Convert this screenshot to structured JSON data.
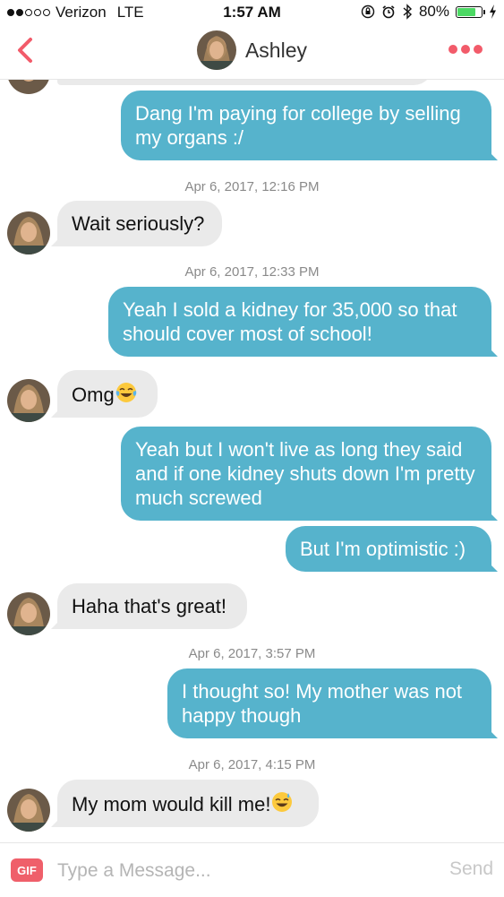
{
  "status_bar": {
    "carrier": "Verizon",
    "network": "LTE",
    "time": "1:57 AM",
    "battery_percent": "80%",
    "battery_level": 0.8,
    "signal_bars": 2,
    "signal_total": 5,
    "icons": [
      "orientation-lock-icon",
      "alarm-icon",
      "bluetooth-icon",
      "battery-icon",
      "charging-icon"
    ]
  },
  "header": {
    "contact_name": "Ashley",
    "back_icon": "chevron-left-icon",
    "more_icon": "more-dots-icon",
    "accent_color": "#f25b6a"
  },
  "colors": {
    "outgoing_bubble": "#56b3cc",
    "incoming_bubble": "#eaeaea"
  },
  "messages": [
    {
      "type": "outgoing",
      "text": "Dang I'm paying for college by selling my organs :/"
    },
    {
      "type": "timestamp",
      "text": "Apr 6, 2017, 12:16 PM"
    },
    {
      "type": "incoming",
      "text": "Wait seriously?"
    },
    {
      "type": "timestamp",
      "text": "Apr 6, 2017, 12:33 PM"
    },
    {
      "type": "outgoing",
      "text": "Yeah I sold a kidney for 35,000 so that should cover most of school!"
    },
    {
      "type": "incoming",
      "text": "Omg",
      "emoji": "tears-of-joy-emoji"
    },
    {
      "type": "outgoing",
      "text": "Yeah but I won't live as long they said and if one kidney shuts down I'm pretty much screwed"
    },
    {
      "type": "outgoing",
      "text": "But I'm optimistic :)"
    },
    {
      "type": "incoming",
      "text": "Haha that's great!"
    },
    {
      "type": "timestamp",
      "text": "Apr 6, 2017, 3:57 PM"
    },
    {
      "type": "outgoing",
      "text": "I thought so! My mother was not happy though"
    },
    {
      "type": "timestamp",
      "text": "Apr 6, 2017, 4:15 PM"
    },
    {
      "type": "incoming",
      "text": "My mom would kill me!",
      "emoji": "sweat-smile-emoji"
    }
  ],
  "composer": {
    "gif_label": "GIF",
    "placeholder": "Type a Message...",
    "send_label": "Send"
  }
}
